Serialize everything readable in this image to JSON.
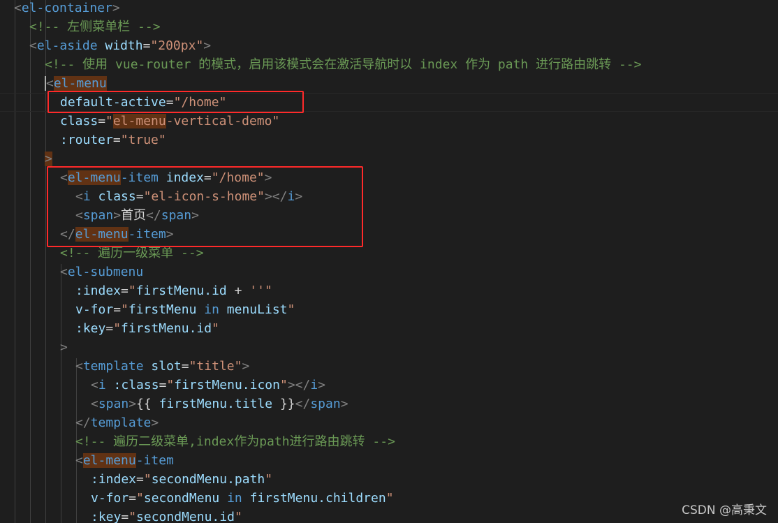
{
  "editor": {
    "theme_colors": {
      "background": "#1e1e1e",
      "tag": "#569cd6",
      "bracket": "#808080",
      "attribute": "#9cdcfe",
      "string": "#ce9178",
      "comment": "#6a9955",
      "text": "#d4d4d4",
      "match_highlight": "#613214",
      "annotation_box": "#ff2a2a"
    },
    "lines": [
      [
        {
          "t": "br",
          "v": "<"
        },
        {
          "t": "tag",
          "v": "el-container"
        },
        {
          "t": "br",
          "v": ">"
        }
      ],
      [
        {
          "t": "com",
          "v": "<!-- 左侧菜单栏 -->"
        }
      ],
      [
        {
          "t": "br",
          "v": "<"
        },
        {
          "t": "tag",
          "v": "el-aside"
        },
        {
          "t": "txt",
          "v": " "
        },
        {
          "t": "attr",
          "v": "width"
        },
        {
          "t": "txt",
          "v": "="
        },
        {
          "t": "str",
          "v": "\"200px\""
        },
        {
          "t": "br",
          "v": ">"
        }
      ],
      [
        {
          "t": "com",
          "v": "<!-- 使用 vue-router 的模式，启用该模式会在激活导航时以 index 作为 path 进行路由跳转 -->"
        }
      ],
      [
        {
          "t": "br",
          "v": "<",
          "caret": true
        },
        {
          "t": "tag",
          "v": "el-menu",
          "hl": true
        }
      ],
      [
        {
          "t": "attr",
          "v": "default-active"
        },
        {
          "t": "txt",
          "v": "="
        },
        {
          "t": "str",
          "v": "\"/home\""
        }
      ],
      [
        {
          "t": "attr",
          "v": "class"
        },
        {
          "t": "txt",
          "v": "="
        },
        {
          "t": "str",
          "v": "\""
        },
        {
          "t": "str",
          "v": "el-menu",
          "hl": true
        },
        {
          "t": "str",
          "v": "-vertical-demo\""
        }
      ],
      [
        {
          "t": "attr",
          "v": ":router"
        },
        {
          "t": "txt",
          "v": "="
        },
        {
          "t": "str",
          "v": "\"true\""
        }
      ],
      [
        {
          "t": "br",
          "v": ">",
          "hl": true
        }
      ],
      [
        {
          "t": "br",
          "v": "<"
        },
        {
          "t": "tag",
          "v": "el-menu",
          "hl": true
        },
        {
          "t": "tag",
          "v": "-item"
        },
        {
          "t": "txt",
          "v": " "
        },
        {
          "t": "attr",
          "v": "index"
        },
        {
          "t": "txt",
          "v": "="
        },
        {
          "t": "str",
          "v": "\"/home\""
        },
        {
          "t": "br",
          "v": ">"
        }
      ],
      [
        {
          "t": "br",
          "v": "<"
        },
        {
          "t": "tag",
          "v": "i"
        },
        {
          "t": "txt",
          "v": " "
        },
        {
          "t": "attr",
          "v": "class"
        },
        {
          "t": "txt",
          "v": "="
        },
        {
          "t": "str",
          "v": "\"el-icon-s-home\""
        },
        {
          "t": "br",
          "v": "></"
        },
        {
          "t": "tag",
          "v": "i"
        },
        {
          "t": "br",
          "v": ">"
        }
      ],
      [
        {
          "t": "br",
          "v": "<"
        },
        {
          "t": "tag",
          "v": "span"
        },
        {
          "t": "br",
          "v": ">"
        },
        {
          "t": "txt",
          "v": "首页"
        },
        {
          "t": "br",
          "v": "</"
        },
        {
          "t": "tag",
          "v": "span"
        },
        {
          "t": "br",
          "v": ">"
        }
      ],
      [
        {
          "t": "br",
          "v": "</"
        },
        {
          "t": "tag",
          "v": "el-menu",
          "hl": true
        },
        {
          "t": "tag",
          "v": "-item"
        },
        {
          "t": "br",
          "v": ">"
        }
      ],
      [
        {
          "t": "com",
          "v": "<!-- 遍历一级菜单 -->"
        }
      ],
      [
        {
          "t": "br",
          "v": "<"
        },
        {
          "t": "tag",
          "v": "el-submenu"
        }
      ],
      [
        {
          "t": "attr",
          "v": ":index"
        },
        {
          "t": "txt",
          "v": "="
        },
        {
          "t": "str",
          "v": "\""
        },
        {
          "t": "attr",
          "v": "firstMenu.id"
        },
        {
          "t": "txt",
          "v": " + "
        },
        {
          "t": "str",
          "v": "''"
        },
        {
          "t": "str",
          "v": "\""
        }
      ],
      [
        {
          "t": "attr",
          "v": "v-for"
        },
        {
          "t": "txt",
          "v": "="
        },
        {
          "t": "str",
          "v": "\""
        },
        {
          "t": "attr",
          "v": "firstMenu"
        },
        {
          "t": "txt",
          "v": " "
        },
        {
          "t": "tag",
          "v": "in"
        },
        {
          "t": "txt",
          "v": " "
        },
        {
          "t": "attr",
          "v": "menuList"
        },
        {
          "t": "str",
          "v": "\""
        }
      ],
      [
        {
          "t": "attr",
          "v": ":key"
        },
        {
          "t": "txt",
          "v": "="
        },
        {
          "t": "str",
          "v": "\""
        },
        {
          "t": "attr",
          "v": "firstMenu.id"
        },
        {
          "t": "str",
          "v": "\""
        }
      ],
      [
        {
          "t": "br",
          "v": ">"
        }
      ],
      [
        {
          "t": "br",
          "v": "<"
        },
        {
          "t": "tag",
          "v": "template"
        },
        {
          "t": "txt",
          "v": " "
        },
        {
          "t": "attr",
          "v": "slot"
        },
        {
          "t": "txt",
          "v": "="
        },
        {
          "t": "str",
          "v": "\"title\""
        },
        {
          "t": "br",
          "v": ">"
        }
      ],
      [
        {
          "t": "br",
          "v": "<"
        },
        {
          "t": "tag",
          "v": "i"
        },
        {
          "t": "txt",
          "v": " "
        },
        {
          "t": "attr",
          "v": ":class"
        },
        {
          "t": "txt",
          "v": "="
        },
        {
          "t": "str",
          "v": "\""
        },
        {
          "t": "attr",
          "v": "firstMenu.icon"
        },
        {
          "t": "str",
          "v": "\""
        },
        {
          "t": "br",
          "v": "></"
        },
        {
          "t": "tag",
          "v": "i"
        },
        {
          "t": "br",
          "v": ">"
        }
      ],
      [
        {
          "t": "br",
          "v": "<"
        },
        {
          "t": "tag",
          "v": "span"
        },
        {
          "t": "br",
          "v": ">"
        },
        {
          "t": "txt",
          "v": "{{ "
        },
        {
          "t": "attr",
          "v": "firstMenu.title"
        },
        {
          "t": "txt",
          "v": " }}"
        },
        {
          "t": "br",
          "v": "</"
        },
        {
          "t": "tag",
          "v": "span"
        },
        {
          "t": "br",
          "v": ">"
        }
      ],
      [
        {
          "t": "br",
          "v": "</"
        },
        {
          "t": "tag",
          "v": "template"
        },
        {
          "t": "br",
          "v": ">"
        }
      ],
      [
        {
          "t": "com",
          "v": "<!-- 遍历二级菜单,index作为path进行路由跳转 -->"
        }
      ],
      [
        {
          "t": "br",
          "v": "<"
        },
        {
          "t": "tag",
          "v": "el-menu",
          "hl": true
        },
        {
          "t": "tag",
          "v": "-item"
        }
      ],
      [
        {
          "t": "attr",
          "v": ":index"
        },
        {
          "t": "txt",
          "v": "="
        },
        {
          "t": "str",
          "v": "\""
        },
        {
          "t": "attr",
          "v": "secondMenu.path"
        },
        {
          "t": "str",
          "v": "\""
        }
      ],
      [
        {
          "t": "attr",
          "v": "v-for"
        },
        {
          "t": "txt",
          "v": "="
        },
        {
          "t": "str",
          "v": "\""
        },
        {
          "t": "attr",
          "v": "secondMenu"
        },
        {
          "t": "txt",
          "v": " "
        },
        {
          "t": "tag",
          "v": "in"
        },
        {
          "t": "txt",
          "v": " "
        },
        {
          "t": "attr",
          "v": "firstMenu.children"
        },
        {
          "t": "str",
          "v": "\""
        }
      ],
      [
        {
          "t": "attr",
          "v": ":key"
        },
        {
          "t": "txt",
          "v": "="
        },
        {
          "t": "str",
          "v": "\""
        },
        {
          "t": "attr",
          "v": "secondMenu.id"
        },
        {
          "t": "str",
          "v": "\""
        }
      ]
    ]
  },
  "watermark": {
    "text": "CSDN @高秉文"
  }
}
